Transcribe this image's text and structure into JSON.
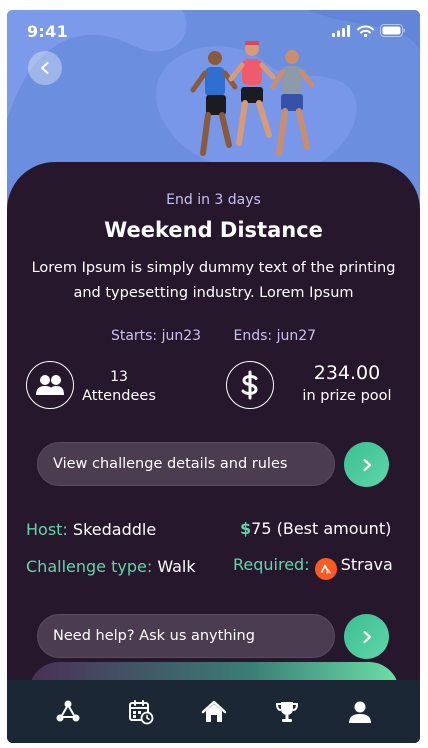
{
  "status_bar": {
    "time": "9:41",
    "icons": [
      "signal-icon",
      "wifi-icon",
      "battery-icon"
    ]
  },
  "hero": {
    "back_icon": "chevron-left-icon",
    "image": "runners-photo"
  },
  "challenge": {
    "ends_in": "End in 3 days",
    "title": "Weekend Distance",
    "description": "Lorem Ipsum is simply dummy text of the printing and typesetting industry. Lorem Ipsum",
    "starts": "Starts: jun23",
    "ends": "Ends: jun27"
  },
  "stats": {
    "attendees_count": "13",
    "attendees_label": "Attendees",
    "attendees_icon": "people-icon",
    "prize_amount": "234.00",
    "prize_label": "in prize pool",
    "prize_icon": "dollar-icon"
  },
  "details_button": {
    "label": "View challenge details and rules",
    "icon": "chevron-right-icon"
  },
  "info": {
    "host_label": "Host:",
    "host_value": "Skedaddle",
    "best_currency": "$",
    "best_amount": "75",
    "best_label": "(Best amount)",
    "type_label": "Challenge type:",
    "type_value": "Walk",
    "required_label": "Required:",
    "required_value": "Strava"
  },
  "help_button": {
    "label": "Need help? Ask us anything",
    "icon": "chevron-right-icon"
  },
  "bottom_nav": {
    "items": [
      "community-icon",
      "calendar-icon",
      "home-icon",
      "trophy-icon",
      "profile-icon"
    ]
  },
  "colors": {
    "background": "#26172c",
    "accent": "#5fd7a8",
    "hero_blue": "#6b8ede",
    "muted_text": "#c7c1ef",
    "pill": "#4b3c4f",
    "nav": "#1c2735",
    "strava": "#fc5a1e"
  }
}
